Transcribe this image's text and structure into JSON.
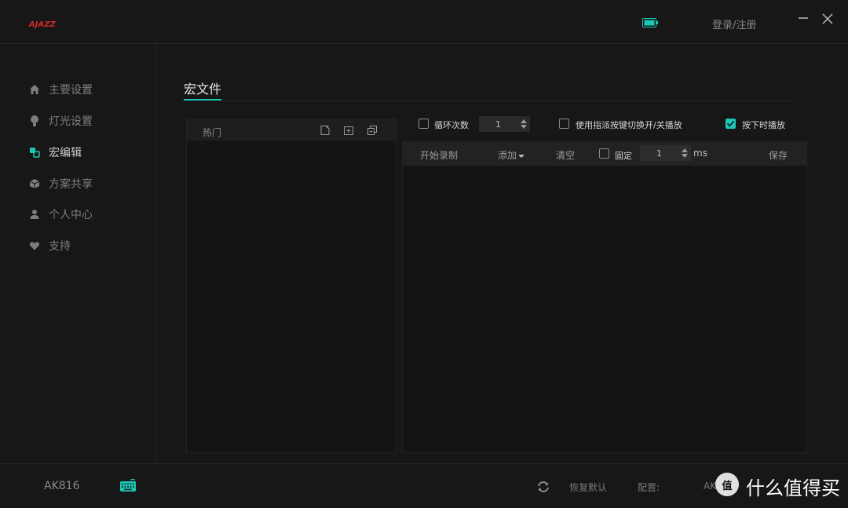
{
  "app": {
    "logo_text": "AJAZZ",
    "login_label": "登录/注册",
    "accent_color": "#1cc7b6",
    "battery_icon": "battery-icon",
    "minimize_icon": "minimize-icon",
    "close_icon": "close-icon"
  },
  "sidebar": {
    "items": [
      {
        "label": "主要设置",
        "icon": "home-icon"
      },
      {
        "label": "灯光设置",
        "icon": "bulb-icon"
      },
      {
        "label": "宏编辑",
        "icon": "macro-icon",
        "active": true
      },
      {
        "label": "方案共享",
        "icon": "cube-icon"
      },
      {
        "label": "个人中心",
        "icon": "user-icon"
      },
      {
        "label": "支持",
        "icon": "heart-icon"
      }
    ]
  },
  "main": {
    "tab_title": "宏文件",
    "list": {
      "header_label": "热门",
      "buttons": [
        "new-file-icon",
        "add-folder-icon",
        "copy-icon"
      ]
    },
    "options": {
      "loop_label": "循环次数",
      "loop_value": "1",
      "loop_checked": false,
      "toggle_label": "使用指派按键切换开/关播放",
      "toggle_checked": false,
      "hold_label": "按下时播放",
      "hold_checked": true
    },
    "editor": {
      "record_label": "开始录制",
      "add_label": "添加",
      "clear_label": "清空",
      "fixed_label": "固定",
      "fixed_checked": false,
      "delay_value": "1",
      "delay_unit": "ms",
      "save_label": "保存"
    }
  },
  "footer": {
    "model": "AK816",
    "restore_label": "恢复默认",
    "config_label": "配置:",
    "config_value": "AK"
  },
  "watermark": {
    "badge": "值",
    "text": "什么值得买"
  }
}
